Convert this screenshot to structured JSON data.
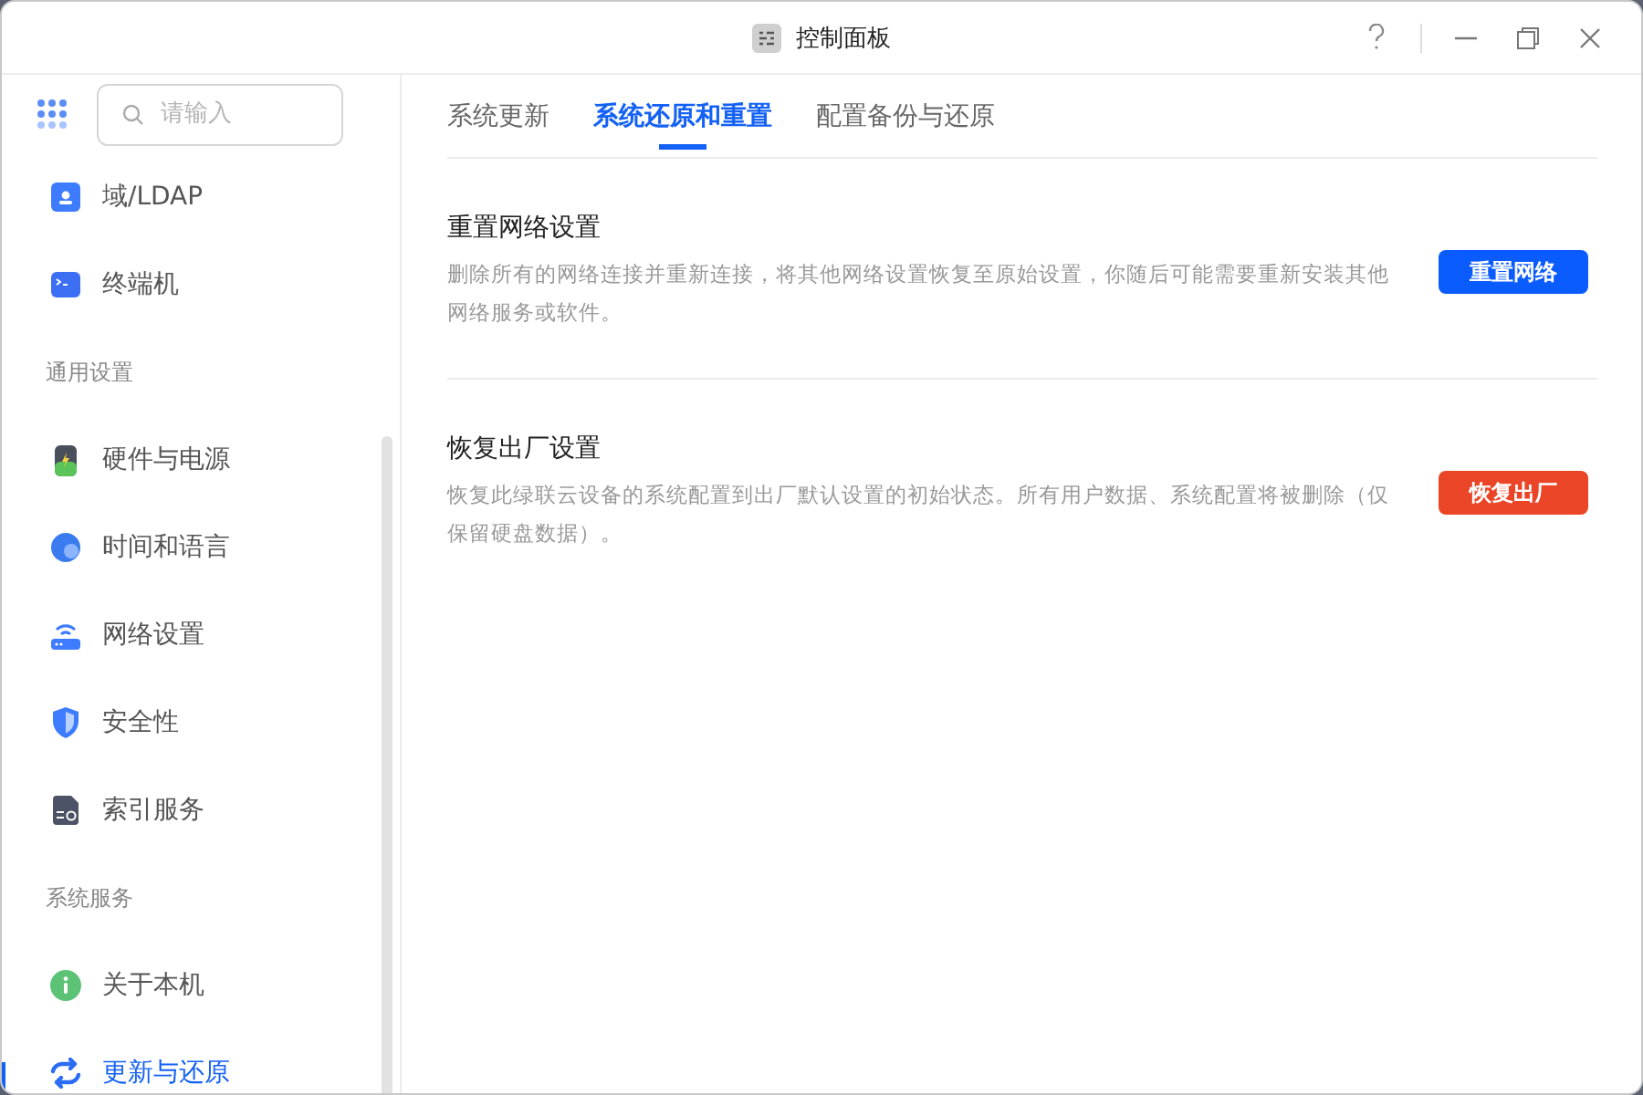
{
  "window": {
    "title": "控制面板"
  },
  "sidebar": {
    "search": {
      "placeholder": "请输入"
    },
    "items": [
      {
        "kind": "item",
        "label": "域/LDAP",
        "selected": false
      },
      {
        "kind": "item",
        "label": "终端机",
        "selected": false
      },
      {
        "kind": "header",
        "label": "通用设置"
      },
      {
        "kind": "item",
        "label": "硬件与电源",
        "selected": false
      },
      {
        "kind": "item",
        "label": "时间和语言",
        "selected": false
      },
      {
        "kind": "item",
        "label": "网络设置",
        "selected": false
      },
      {
        "kind": "item",
        "label": "安全性",
        "selected": false
      },
      {
        "kind": "item",
        "label": "索引服务",
        "selected": false
      },
      {
        "kind": "header",
        "label": "系统服务"
      },
      {
        "kind": "item",
        "label": "关于本机",
        "selected": false
      },
      {
        "kind": "item",
        "label": "更新与还原",
        "selected": true
      }
    ]
  },
  "tabs": [
    {
      "label": "系统更新",
      "selected": false
    },
    {
      "label": "系统还原和重置",
      "selected": true
    },
    {
      "label": "配置备份与还原",
      "selected": false
    }
  ],
  "sections": [
    {
      "title": "重置网络设置",
      "description": "删除所有的网络连接并重新连接，将其他网络设置恢复至原始设置，你随后可能需要重新安装其他网络服务或软件。",
      "button": {
        "label": "重置网络",
        "kind": "primary"
      }
    },
    {
      "title": "恢复出厂设置",
      "description": "恢复此绿联云设备的系统配置到出厂默认设置的初始状态。所有用户数据、系统配置将被删除（仅保留硬盘数据）。",
      "button": {
        "label": "恢复出厂",
        "kind": "danger"
      }
    }
  ]
}
